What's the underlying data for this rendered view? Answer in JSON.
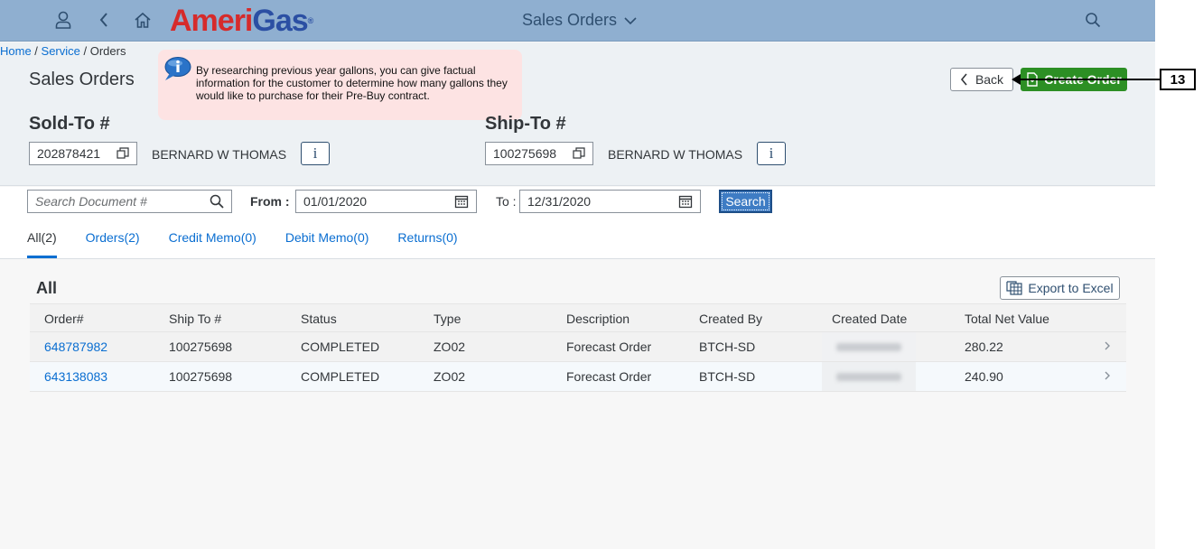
{
  "shell": {
    "title": "Sales Orders",
    "logo_part1": "Ameri",
    "logo_part2": "Gas",
    "logo_reg": "®",
    "icons": [
      "user-icon",
      "back-arrow-icon",
      "home-icon",
      "chevron-down-icon",
      "search-icon"
    ]
  },
  "breadcrumb": {
    "home": "Home",
    "service": "Service",
    "current": "Orders",
    "sep": " / "
  },
  "page": {
    "title": "Sales Orders"
  },
  "tooltip": {
    "text": "By researching previous year gallons, you can give factual information for the customer to determine how many gallons they would like to purchase for their Pre-Buy contract."
  },
  "actions": {
    "back_label": "Back",
    "create_label": "Create Order"
  },
  "sold_to": {
    "label": "Sold-To #",
    "id": "202878421",
    "name": "BERNARD W THOMAS",
    "info": "i"
  },
  "ship_to": {
    "label": "Ship-To #",
    "id": "100275698",
    "name": "BERNARD W THOMAS",
    "info": "i"
  },
  "filters": {
    "search_placeholder": "Search Document #",
    "from_label": "From :",
    "from_value": "01/01/2020",
    "to_label": "To :",
    "to_value": "12/31/2020",
    "search_button": "Search"
  },
  "tabs": [
    "All(2)",
    "Orders(2)",
    "Credit Memo(0)",
    "Debit Memo(0)",
    "Returns(0)"
  ],
  "table": {
    "title": "All",
    "export_label": "Export to Excel",
    "columns": [
      "Order#",
      "Ship To #",
      "Status",
      "Type",
      "Description",
      "Created By",
      "Created Date",
      "Total Net Value"
    ],
    "rows": [
      [
        "648787982",
        "100275698",
        "COMPLETED",
        "ZO02",
        "Forecast Order",
        "BTCH-SD",
        "",
        "280.22"
      ],
      [
        "643138083",
        "100275698",
        "COMPLETED",
        "ZO02",
        "Forecast Order",
        "BTCH-SD",
        "",
        "240.90"
      ]
    ]
  },
  "callout": {
    "number": "13"
  },
  "colors": {
    "shell": "#8fafd0",
    "create_button": "#2c8f24",
    "link": "#0a6ed1",
    "tooltip_bg": "#fde3e3"
  }
}
